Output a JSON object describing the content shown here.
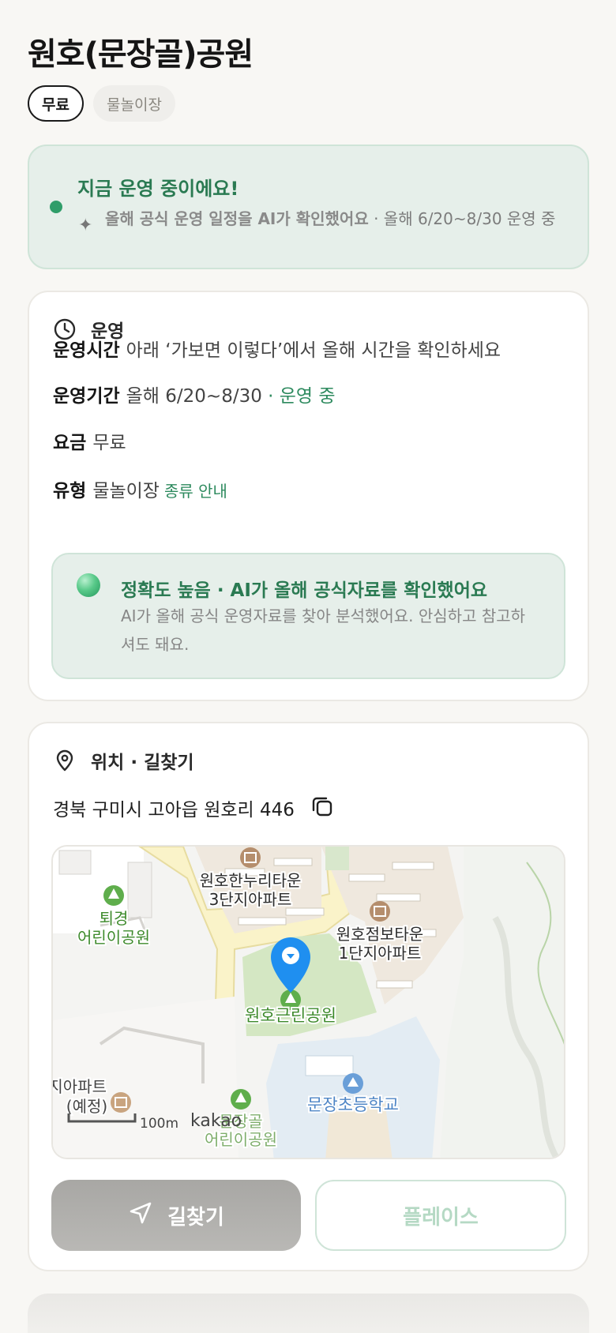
{
  "header": {
    "title": "원호(문장골)공원",
    "chips": [
      "무료",
      "물놀이장"
    ]
  },
  "status": {
    "headline": "지금 운영 중이에요!",
    "ai_check": "올해 공식 운영 일정을 AI가 확인했어요",
    "detail": " · 올해 6/20~8/30 운영 중"
  },
  "operations": {
    "section_label": "운영",
    "rows": [
      {
        "key": "운영시간",
        "value": "아래 ‘가보면 이렇다’에서 올해 시간을 확인하세요"
      },
      {
        "key": "운영기간",
        "value": "올해 6/20~8/30",
        "suffix": " · 운영 중"
      },
      {
        "key": "요금",
        "value": "무료"
      },
      {
        "key": "유형",
        "value": "물놀이장",
        "link": "종류 안내"
      }
    ],
    "accuracy": {
      "title": "정확도 높음 · AI가 올해 공식자료를 확인했어요",
      "desc": "AI가 올해 공식 운영자료를 찾아 분석했어요. 안심하고 참고하셔도 돼요."
    }
  },
  "location": {
    "section_label": "위치 · 길찾기",
    "address": "경북 구미시 고아읍 원호리 446",
    "map": {
      "labels": {
        "apt1": [
          "원호한누리타운",
          "3단지아파트"
        ],
        "park1": [
          "퇴경",
          "어린이공원"
        ],
        "apt2": [
          "원호점보타운",
          "1단지아파트"
        ],
        "park_main": "원호근린공원",
        "apt3": [
          "지아파트",
          "(예정)"
        ],
        "park2": [
          "문장골",
          "어린이공원"
        ],
        "school": "문장초등학교",
        "scale": "100m",
        "provider": "kakao"
      }
    },
    "route_button": "길찾기",
    "place_button": "플레이스"
  },
  "colors": {
    "accent_green": "#2d8a5e",
    "status_bg": "#e6efea",
    "pin_blue": "#1f8ff0"
  }
}
